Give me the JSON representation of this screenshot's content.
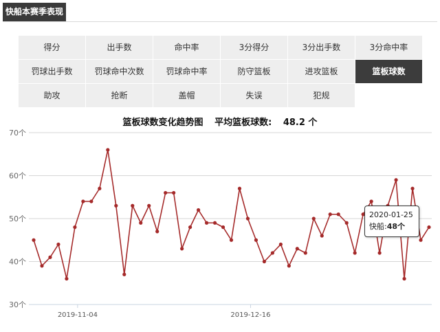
{
  "header": {
    "title": "快船本赛季表现"
  },
  "stats_tabs": [
    {
      "label": "得分"
    },
    {
      "label": "出手数"
    },
    {
      "label": "命中率"
    },
    {
      "label": "3分得分"
    },
    {
      "label": "3分出手数"
    },
    {
      "label": "3分命中率"
    },
    {
      "label": "罚球出手数"
    },
    {
      "label": "罚球命中次数"
    },
    {
      "label": "罚球命中率"
    },
    {
      "label": "防守篮板"
    },
    {
      "label": "进攻篮板"
    },
    {
      "label": "篮板球数",
      "active": true
    },
    {
      "label": "助攻"
    },
    {
      "label": "抢断"
    },
    {
      "label": "盖帽"
    },
    {
      "label": "失误"
    },
    {
      "label": "犯规"
    }
  ],
  "chart_header": {
    "title": "篮板球数变化趋势图",
    "avg_label": "平均篮板球数:",
    "avg_value": "48.2 个"
  },
  "tooltip": {
    "date": "2020-01-25",
    "team": "快船:",
    "value": "48个"
  },
  "chart_data": {
    "type": "line",
    "title": "篮板球数变化趋势图",
    "ylim": [
      30,
      70
    ],
    "y_ticks": [
      "30个",
      "40个",
      "50个",
      "60个",
      "70个"
    ],
    "x_tick_labels": [
      "2019-11-04",
      "2019-12-16"
    ],
    "grid": true,
    "series": [
      {
        "color": "#a52a2a",
        "values": [
          45,
          39,
          41,
          44,
          36,
          48,
          54,
          54,
          57,
          66,
          53,
          37,
          53,
          49,
          53,
          47,
          56,
          56,
          43,
          48,
          52,
          49,
          49,
          48,
          45,
          57,
          50,
          45,
          40,
          42,
          44,
          39,
          43,
          42,
          50,
          46,
          51,
          51,
          49,
          42,
          51,
          54,
          42,
          53,
          59,
          36,
          57,
          45,
          48
        ]
      }
    ]
  }
}
